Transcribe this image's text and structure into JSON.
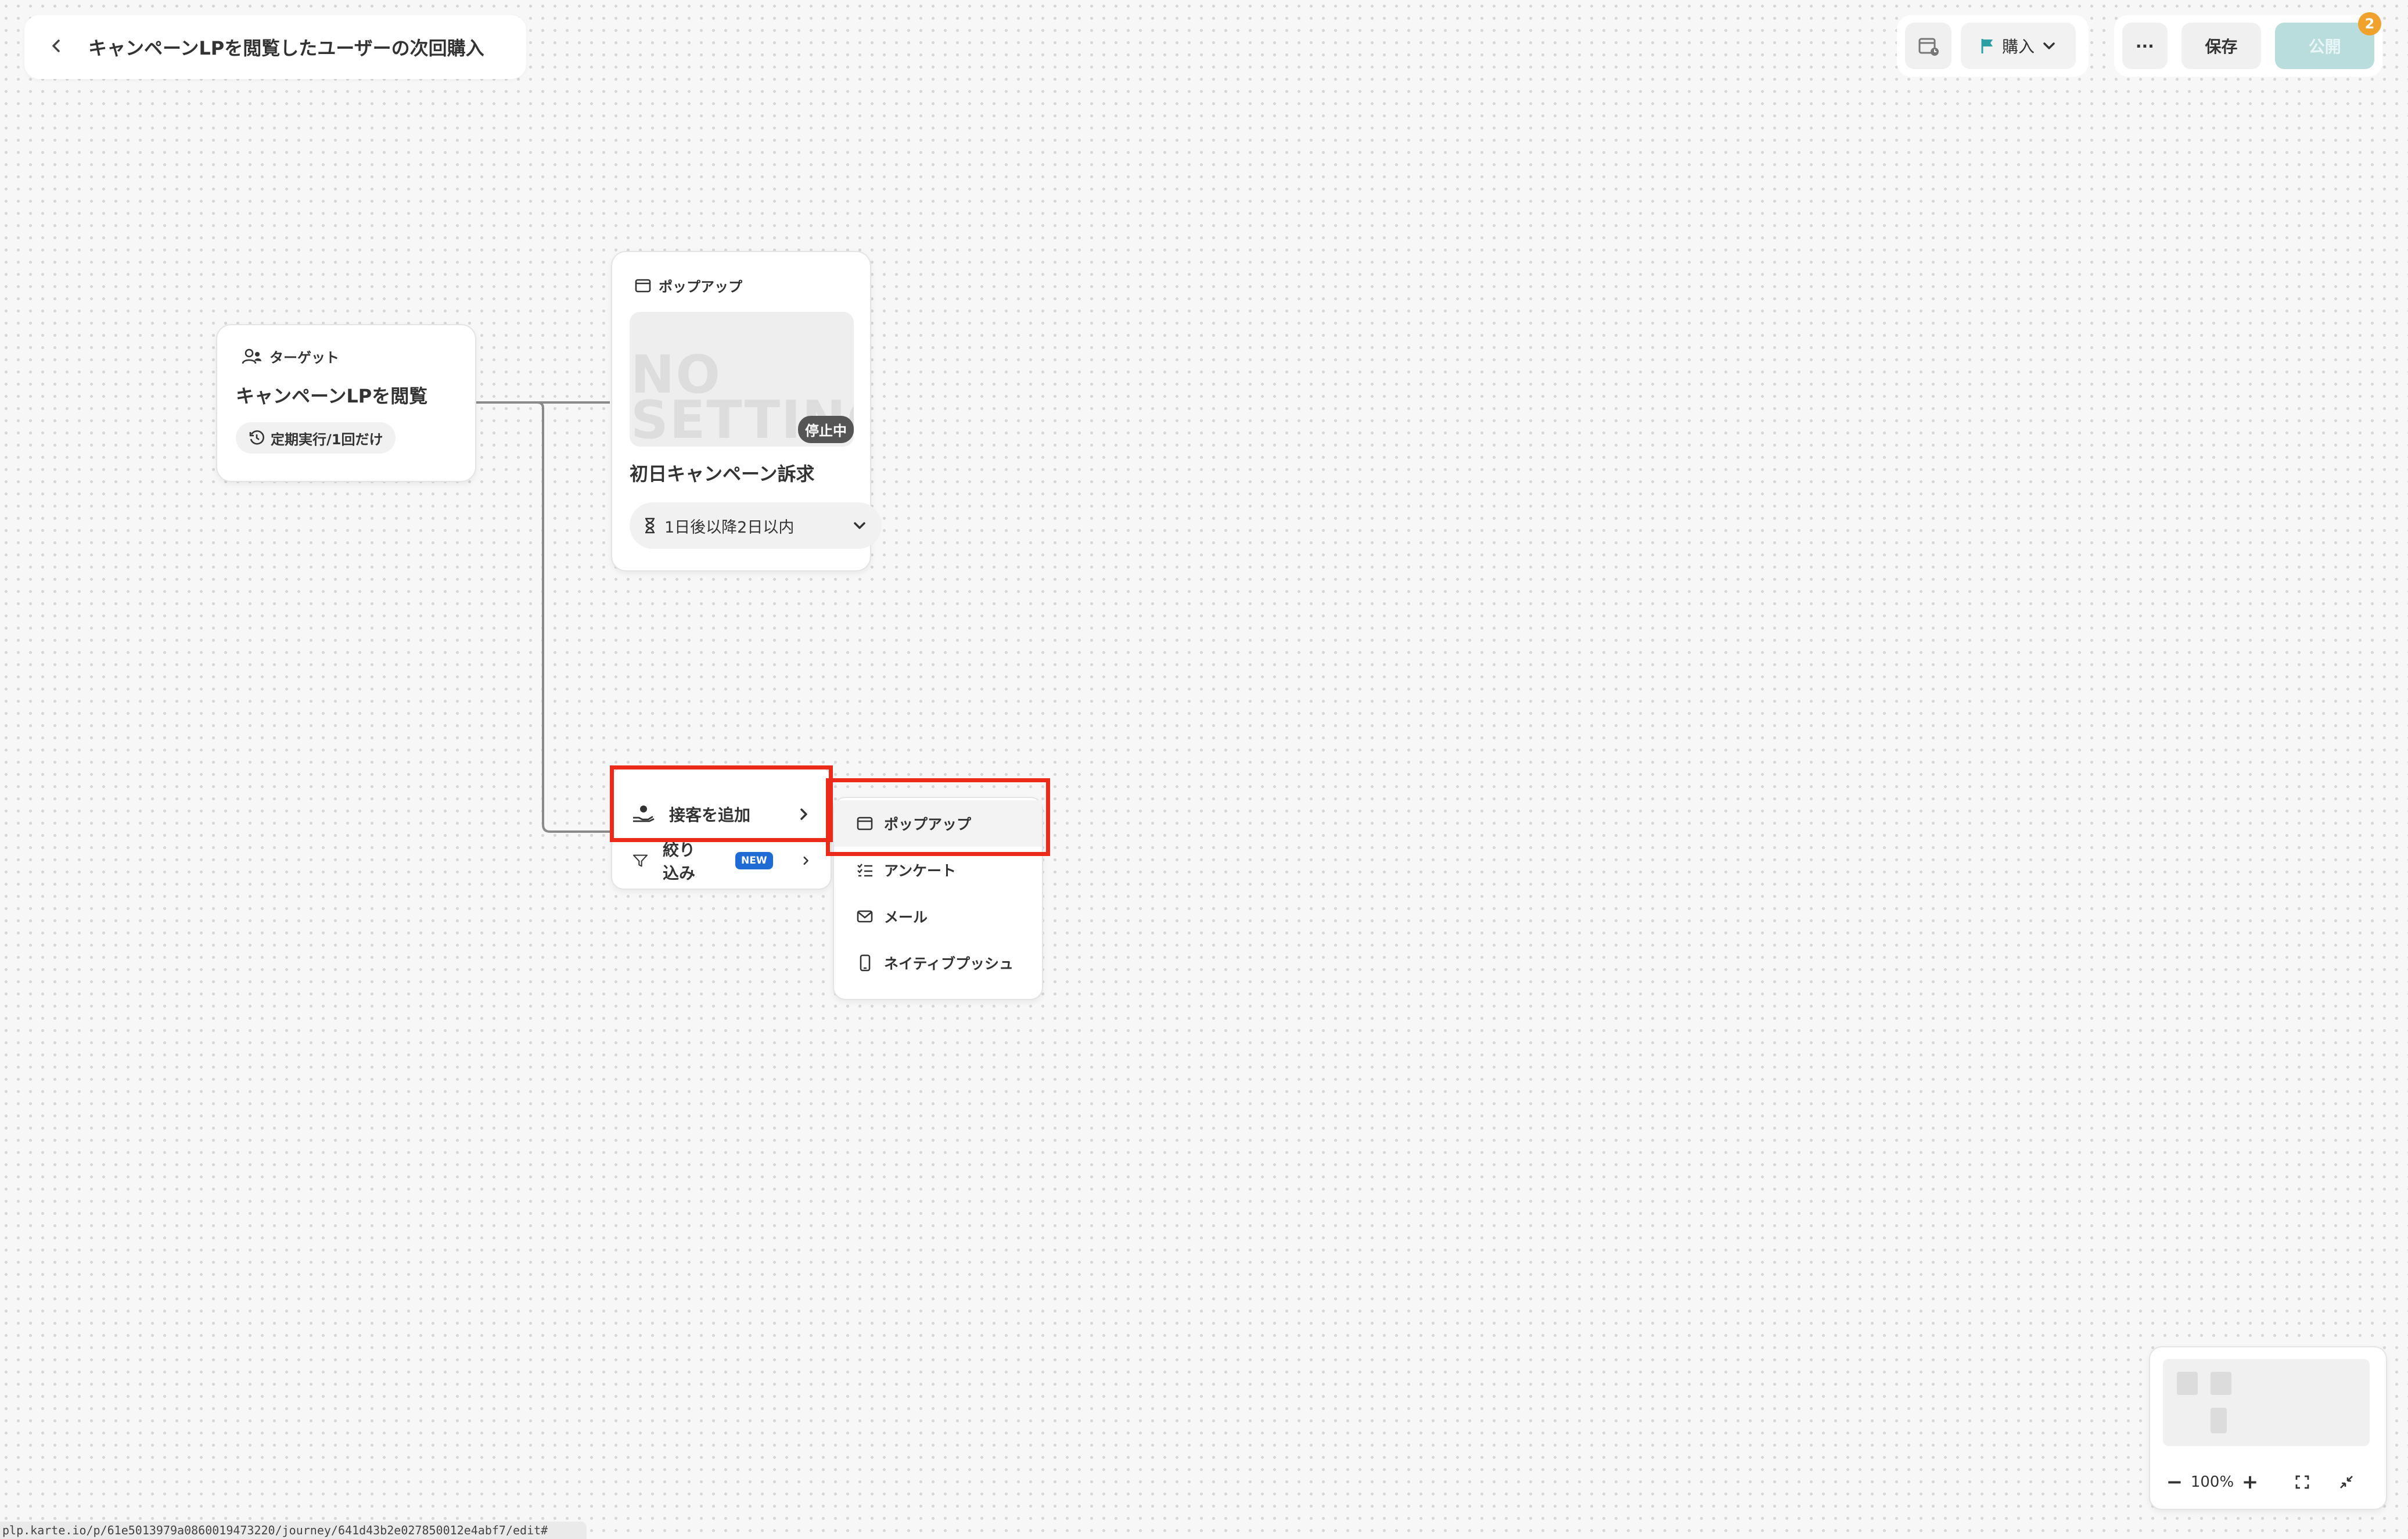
{
  "header": {
    "back_icon": "chevron-left",
    "title": "キャンペーンLPを閲覧したユーザーの次回購入",
    "calendar_icon": "calendar-icon",
    "goal_label": "購入",
    "goal_icon": "flag-icon",
    "more_label": "···",
    "save_label": "保存",
    "publish_label": "公開",
    "publish_badge": "2"
  },
  "colors": {
    "accent": "#2aa0a4",
    "highlight": "#ec2a1a",
    "new_badge": "#1f6bd6",
    "notification": "#f0a22c"
  },
  "target_node": {
    "type_label": "ターゲット",
    "title": "キャンペーンLPを閲覧",
    "schedule_chip": "定期実行/1回だけ"
  },
  "popup_node": {
    "type_label": "ポップアップ",
    "thumbnail_text": "NO SETTING",
    "status_badge": "停止中",
    "title": "初日キャンペーン訴求",
    "wait_label": "1日後以降2日以内"
  },
  "action_menu": {
    "items": [
      {
        "label": "接客を追加"
      },
      {
        "label": "絞り込み",
        "badge": "NEW"
      }
    ]
  },
  "action_submenu": {
    "items": [
      {
        "label": "ポップアップ"
      },
      {
        "label": "アンケート"
      },
      {
        "label": "メール"
      },
      {
        "label": "ネイティブプッシュ"
      }
    ]
  },
  "zoom": {
    "level": "100%",
    "minus": "−",
    "plus": "+"
  },
  "status_url": "plp.karte.io/p/61e5013979a0860019473220/journey/641d43b2e027850012e4abf7/edit#"
}
